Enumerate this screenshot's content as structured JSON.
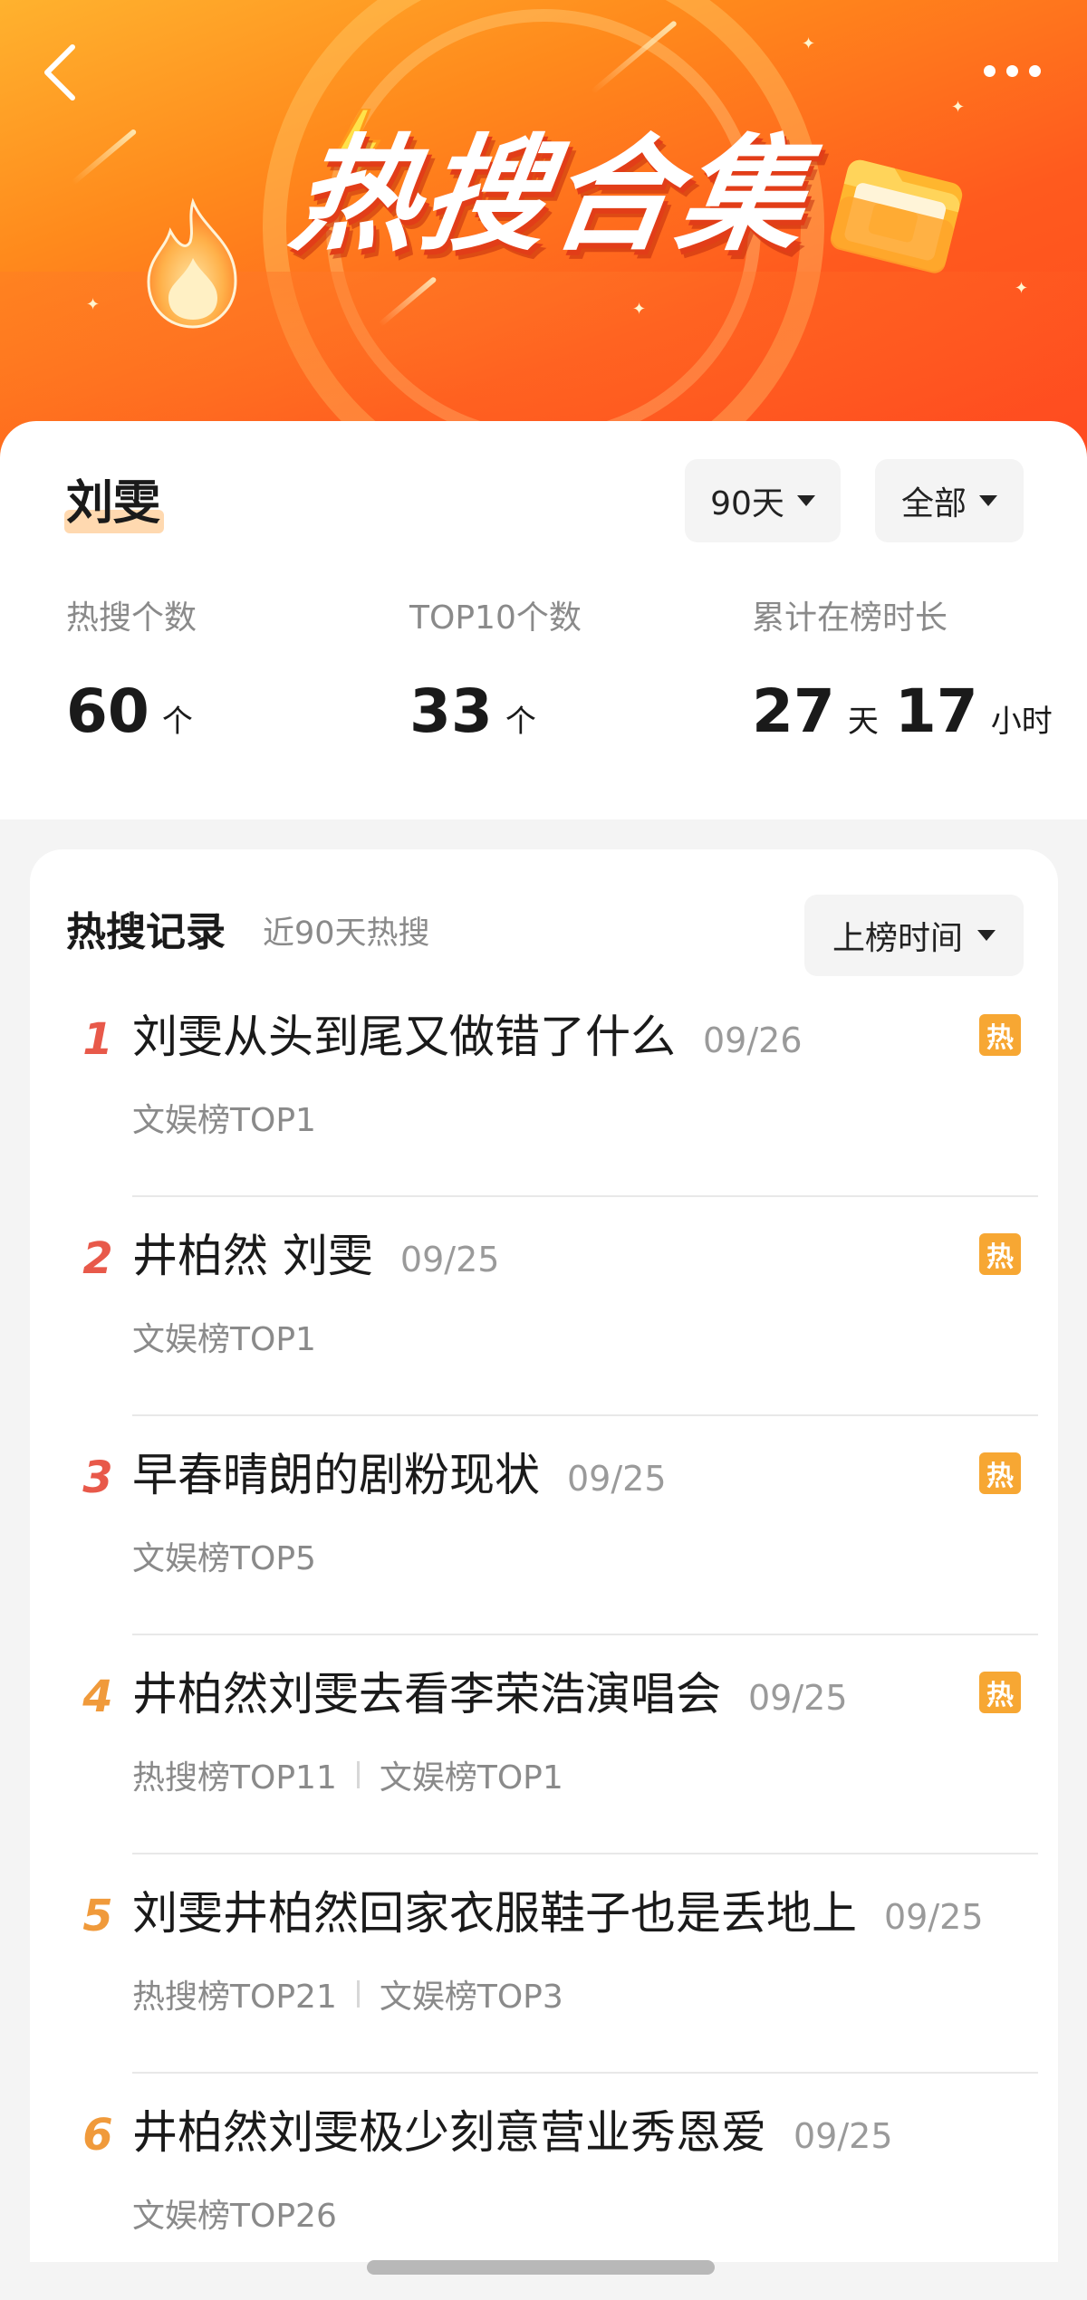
{
  "banner": {
    "title": "热搜合集",
    "back_icon": "chevron-left-icon",
    "more_icon": "more-horizontal-icon"
  },
  "summary": {
    "name": "刘雯",
    "filters": {
      "days": "90天",
      "scope": "全部"
    },
    "stats": [
      {
        "label": "热搜个数",
        "value": "60",
        "unit": "个"
      },
      {
        "label": "TOP10个数",
        "value": "33",
        "unit": "个"
      },
      {
        "label": "累计在榜时长",
        "value_days": "27",
        "unit_days": "天",
        "value_hours": "17",
        "unit_hours": "小时"
      }
    ]
  },
  "records": {
    "title": "热搜记录",
    "subtitle": "近90天热搜",
    "sort_label": "上榜时间",
    "hot_badge_label": "热",
    "items": [
      {
        "rank": "1",
        "topic": "刘雯从头到尾又做错了什么",
        "date": "09/26",
        "tags": [
          "文娱榜TOP1"
        ],
        "hot": true
      },
      {
        "rank": "2",
        "topic": "井柏然 刘雯",
        "date": "09/25",
        "tags": [
          "文娱榜TOP1"
        ],
        "hot": true
      },
      {
        "rank": "3",
        "topic": "早春晴朗的剧粉现状",
        "date": "09/25",
        "tags": [
          "文娱榜TOP5"
        ],
        "hot": true
      },
      {
        "rank": "4",
        "topic": "井柏然刘雯去看李荣浩演唱会",
        "date": "09/25",
        "tags": [
          "热搜榜TOP11",
          "文娱榜TOP1"
        ],
        "hot": true
      },
      {
        "rank": "5",
        "topic": "刘雯井柏然回家衣服鞋子也是丢地上",
        "date": "09/25",
        "tags": [
          "热搜榜TOP21",
          "文娱榜TOP3"
        ],
        "hot": false
      },
      {
        "rank": "6",
        "topic": "井柏然刘雯极少刻意营业秀恩爱",
        "date": "09/25",
        "tags": [
          "文娱榜TOP26"
        ],
        "hot": false
      }
    ]
  },
  "colors": {
    "banner_orange": "#ff5a1e",
    "rank_top": "#e8594a",
    "rank_mid": "#f09a3b",
    "hot_badge": "#f7a733"
  }
}
